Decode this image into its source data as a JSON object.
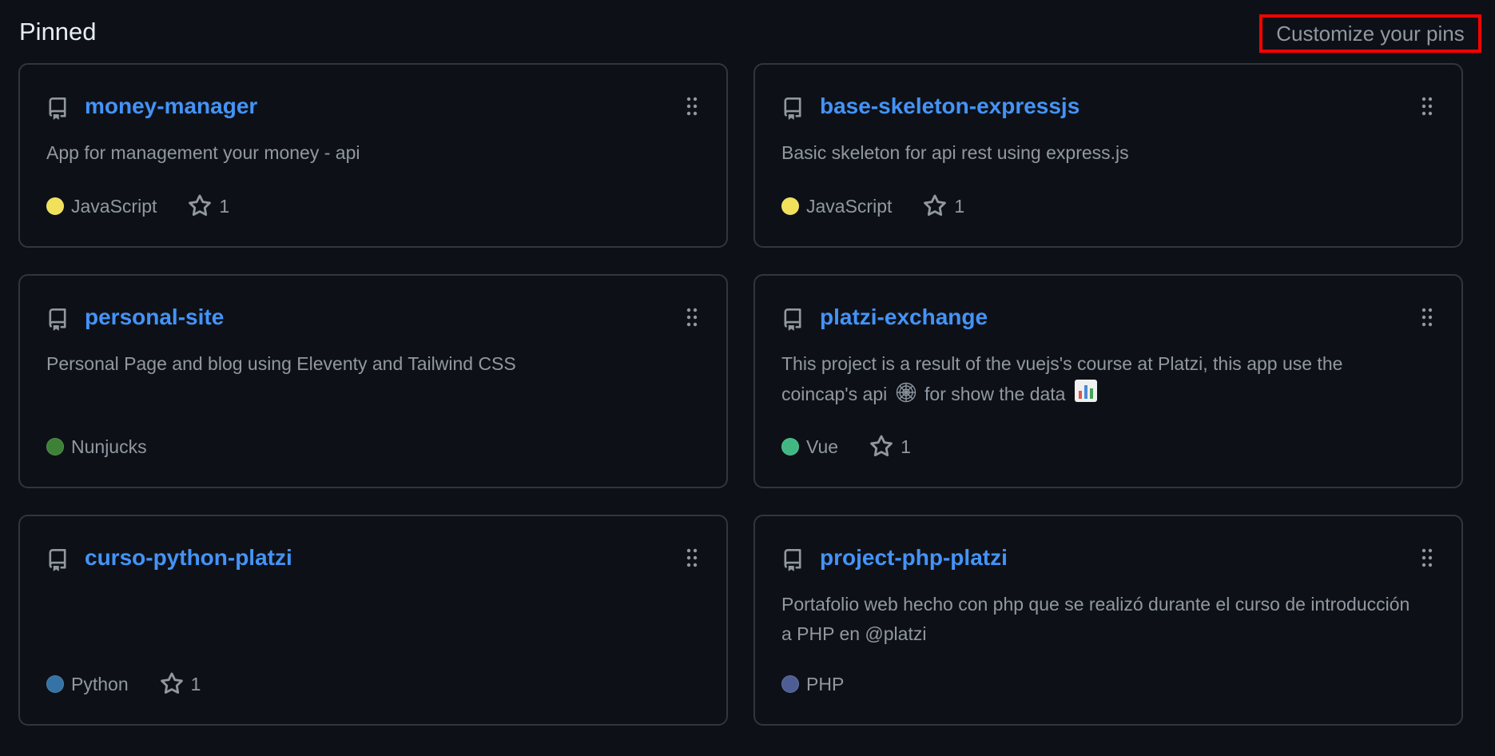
{
  "section": {
    "title": "Pinned",
    "customize_label": "Customize your pins"
  },
  "colors": {
    "JavaScript": "#f1e05a",
    "Nunjucks": "#3d8137",
    "Vue": "#41b883",
    "Python": "#3572a5",
    "PHP": "#4f5d95",
    "link": "#4493f8",
    "muted": "#9198a1",
    "border": "#30363d",
    "background": "#0d1117",
    "highlight": "#ff0000"
  },
  "repos": [
    {
      "name": "money-manager",
      "description": "App for management your money - api",
      "language": "JavaScript",
      "stars": "1"
    },
    {
      "name": "base-skeleton-expressjs",
      "description": "Basic skeleton for api rest using express.js",
      "language": "JavaScript",
      "stars": "1"
    },
    {
      "name": "personal-site",
      "description": "Personal Page and blog using Eleventy and Tailwind CSS",
      "language": "Nunjucks",
      "stars": null
    },
    {
      "name": "platzi-exchange",
      "description_parts": [
        "This project is a result of the vuejs's course at Platzi, this app use the coincap's api",
        "for show the data"
      ],
      "description_icons": [
        "spider-web-icon",
        "bar-chart-icon"
      ],
      "language": "Vue",
      "stars": "1"
    },
    {
      "name": "curso-python-platzi",
      "description": "",
      "language": "Python",
      "stars": "1"
    },
    {
      "name": "project-php-platzi",
      "description": "Portafolio web hecho con php que se realizó durante el curso de introducción a PHP en @platzi",
      "language": "PHP",
      "stars": null
    }
  ]
}
